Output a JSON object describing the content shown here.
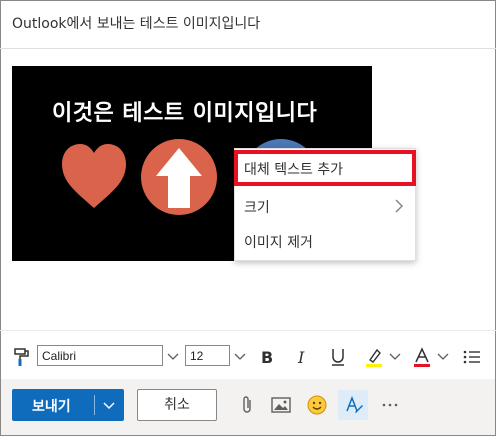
{
  "subject": "Outlook에서 보내는 테스트 이미지입니다",
  "image": {
    "title": "이것은 테스트 이미지입니다",
    "background": "#000000",
    "shapes": [
      "heart-shape",
      "up-arrow-circle",
      "partial-circle"
    ]
  },
  "context_menu": {
    "items": [
      {
        "label": "대체 텍스트 추가",
        "highlighted": true
      },
      {
        "label": "크기",
        "has_submenu": true
      },
      {
        "label": "이미지 제거"
      }
    ]
  },
  "formatting": {
    "font": "Calibri",
    "size": "12",
    "icons": [
      "format-painter-icon",
      "bold-icon",
      "italic-icon",
      "underline-icon",
      "highlight-icon",
      "font-color-icon",
      "bullets-icon"
    ]
  },
  "footer": {
    "send_label": "보내기",
    "cancel_label": "취소",
    "icons": [
      "attach-icon",
      "insert-image-icon",
      "emoji-icon",
      "accessibility-icon",
      "more-options-icon"
    ]
  },
  "colors": {
    "accent": "#0f6cbd",
    "highlight_border": "#e81123",
    "heart": "#d9634b",
    "arrow_circle": "#d9634b",
    "third_circle": "#4a78b5",
    "highlight_marker": "#fff100",
    "font_color": "#e81123"
  }
}
